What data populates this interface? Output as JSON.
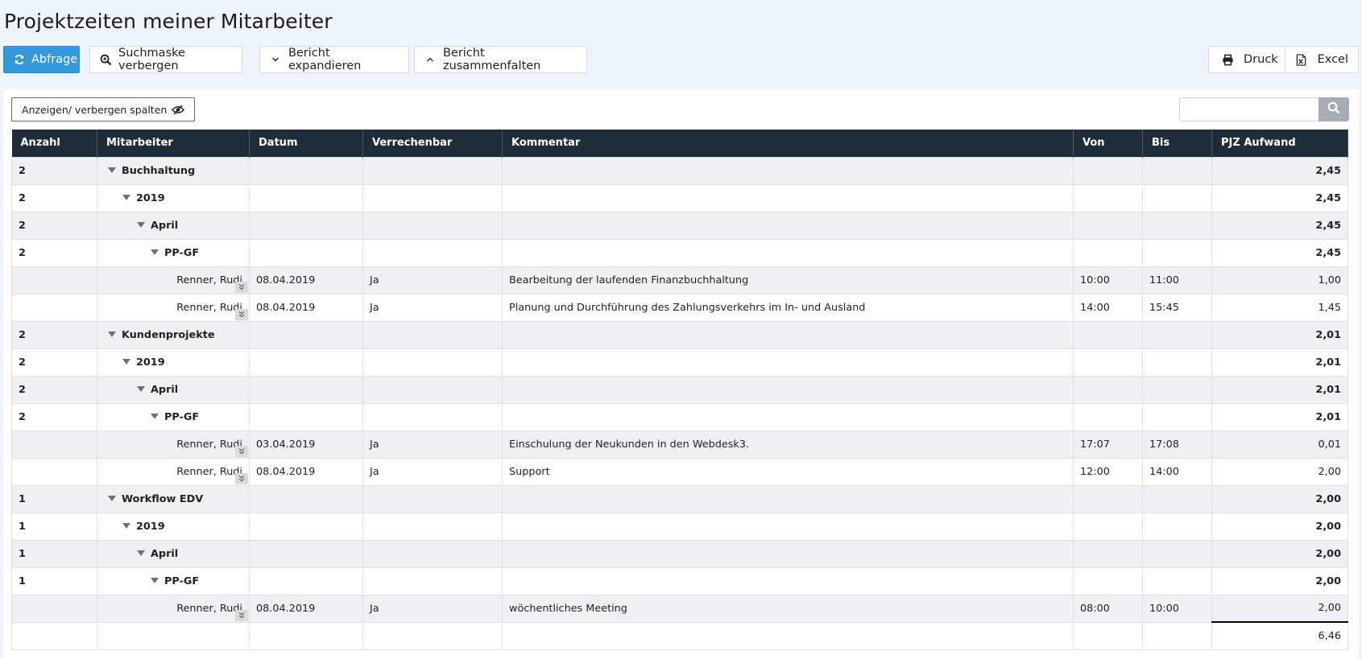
{
  "page": {
    "title": "Projektzeiten meiner Mitarbeiter"
  },
  "toolbar": {
    "abfrage": "Abfrage",
    "suchmaske": "Suchmaske verbergen",
    "expandieren": "Bericht expandieren",
    "zusammenfalten": "Bericht zusammenfalten",
    "druck": "Druck",
    "excel": "Excel"
  },
  "controls": {
    "columns_toggle": "Anzeigen/ verbergen spalten",
    "search_placeholder": ""
  },
  "table": {
    "headers": [
      "Anzahl",
      "Mitarbeiter",
      "Datum",
      "Verrechenbar",
      "Kommentar",
      "Von",
      "Bis",
      "PJZ Aufwand"
    ],
    "rows": [
      {
        "type": "group",
        "level": 0,
        "anzahl": "2",
        "label": "Buchhaltung",
        "aufwand": "2,45"
      },
      {
        "type": "group",
        "level": 1,
        "anzahl": "2",
        "label": "2019",
        "aufwand": "2,45"
      },
      {
        "type": "group",
        "level": 2,
        "anzahl": "2",
        "label": "April",
        "aufwand": "2,45"
      },
      {
        "type": "group",
        "level": 3,
        "anzahl": "2",
        "label": "PP-GF",
        "aufwand": "2,45"
      },
      {
        "type": "detail",
        "mitarbeiter": "Renner, Rudi",
        "datum": "08.04.2019",
        "verrechenbar": "Ja",
        "kommentar": "Bearbeitung der laufenden Finanzbuchhaltung",
        "von": "10:00",
        "bis": "11:00",
        "aufwand": "1,00"
      },
      {
        "type": "detail",
        "mitarbeiter": "Renner, Rudi",
        "datum": "08.04.2019",
        "verrechenbar": "Ja",
        "kommentar": "Planung und Durchführung des Zahlungsverkehrs im In- und Ausland",
        "von": "14:00",
        "bis": "15:45",
        "aufwand": "1,45"
      },
      {
        "type": "group",
        "level": 0,
        "anzahl": "2",
        "label": "Kundenprojekte",
        "aufwand": "2,01"
      },
      {
        "type": "group",
        "level": 1,
        "anzahl": "2",
        "label": "2019",
        "aufwand": "2,01"
      },
      {
        "type": "group",
        "level": 2,
        "anzahl": "2",
        "label": "April",
        "aufwand": "2,01"
      },
      {
        "type": "group",
        "level": 3,
        "anzahl": "2",
        "label": "PP-GF",
        "aufwand": "2,01"
      },
      {
        "type": "detail",
        "mitarbeiter": "Renner, Rudi",
        "datum": "03.04.2019",
        "verrechenbar": "Ja",
        "kommentar": "Einschulung der Neukunden in den Webdesk3.",
        "von": "17:07",
        "bis": "17:08",
        "aufwand": "0,01"
      },
      {
        "type": "detail",
        "mitarbeiter": "Renner, Rudi",
        "datum": "08.04.2019",
        "verrechenbar": "Ja",
        "kommentar": "Support",
        "von": "12:00",
        "bis": "14:00",
        "aufwand": "2,00"
      },
      {
        "type": "group",
        "level": 0,
        "anzahl": "1",
        "label": "Workflow EDV",
        "aufwand": "2,00"
      },
      {
        "type": "group",
        "level": 1,
        "anzahl": "1",
        "label": "2019",
        "aufwand": "2,00"
      },
      {
        "type": "group",
        "level": 2,
        "anzahl": "1",
        "label": "April",
        "aufwand": "2,00"
      },
      {
        "type": "group",
        "level": 3,
        "anzahl": "1",
        "label": "PP-GF",
        "aufwand": "2,00"
      },
      {
        "type": "detail",
        "mitarbeiter": "Renner, Rudi",
        "datum": "08.04.2019",
        "verrechenbar": "Ja",
        "kommentar": "wöchentliches Meeting",
        "von": "08:00",
        "bis": "10:00",
        "aufwand": "2,00"
      }
    ],
    "total": "6,46"
  }
}
